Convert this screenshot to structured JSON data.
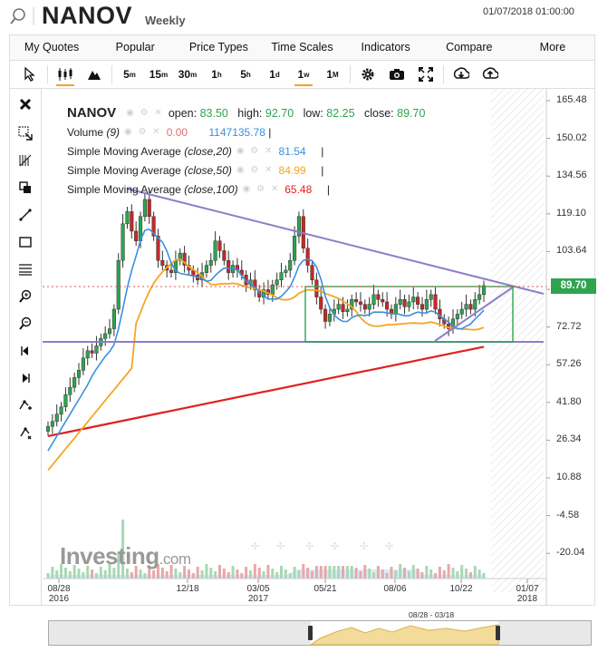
{
  "header": {
    "symbol": "NANOV",
    "period": "Weekly",
    "datetime": "01/07/2018 01:00:00",
    "search_icon": "search-icon"
  },
  "menu": {
    "items": [
      "My Quotes",
      "Popular",
      "Price Types",
      "Time Scales",
      "Indicators",
      "Compare",
      "More"
    ]
  },
  "toolbar": {
    "cursor_icon": "cursor-arrow-icon",
    "candles_icon": "candlestick-icon",
    "area_icon": "mountain-chart-icon",
    "timeframes": [
      "5",
      "15",
      "30",
      "1",
      "5",
      "1",
      "1",
      "1"
    ],
    "timeframe_units": [
      "m",
      "m",
      "m",
      "h",
      "h",
      "d",
      "w",
      "M"
    ],
    "active_timeframe": "1w",
    "settings_icon": "gear-icon",
    "camera_icon": "camera-icon",
    "fullscreen_icon": "fullscreen-icon",
    "download_icon": "download-icon",
    "upload_icon": "upload-icon"
  },
  "left_tools": [
    "close-icon",
    "crosshair-icon",
    "fibonacci-icon",
    "copy-icon",
    "line-tool-icon",
    "rectangle-icon",
    "horizontal-lines-icon",
    "zoom-in-icon",
    "zoom-out-icon",
    "back-icon",
    "forward-icon",
    "magnet-icon",
    "pointer-icon"
  ],
  "legend": {
    "title": "NANOV",
    "open_label": "open:",
    "open": "83.50",
    "high_label": "high:",
    "high": "92.70",
    "low_label": "low:",
    "low": "82.25",
    "close_label": "close:",
    "close": "89.70",
    "volume_label": "Volume",
    "volume_param": "(9)",
    "volume_ma": "0.00",
    "volume": "1147135.78",
    "sma20_label": "Simple Moving Average",
    "sma20_param": "(close,20)",
    "sma20": "81.54",
    "sma50_label": "Simple Moving Average",
    "sma50_param": "(close,50)",
    "sma50": "84.99",
    "sma100_label": "Simple Moving Average",
    "sma100_param": "(close,100)",
    "sma100": "65.48",
    "colors": {
      "sma20": "#3b8fe0",
      "sma50": "#f5a623",
      "sma100": "#e02020",
      "volume_ma": "#e07070",
      "volume": "#3b8fe0",
      "up": "#2ea44f",
      "down": "#c62828"
    }
  },
  "price_tag": "89.70",
  "chart_data": {
    "type": "candlestick",
    "y_axis_labels": [
      "165.48",
      "150.02",
      "134.56",
      "119.10",
      "103.64",
      "88.18",
      "72.72",
      "57.26",
      "41.80",
      "26.34",
      "10.88",
      "-4.58",
      "-20.04"
    ],
    "x_axis_labels": [
      {
        "top": "08/28",
        "bottom": "2016"
      },
      {
        "top": "12/18",
        "bottom": ""
      },
      {
        "top": "03/05",
        "bottom": "2017"
      },
      {
        "top": "05/21",
        "bottom": ""
      },
      {
        "top": "08/06",
        "bottom": ""
      },
      {
        "top": "10/22",
        "bottom": ""
      },
      {
        "top": "01/07",
        "bottom": "2018"
      }
    ],
    "ylim": [
      -20.04,
      165.48
    ],
    "last_close": 89.7,
    "series": [
      {
        "name": "SMA(close,20)",
        "color": "#3b8fe0"
      },
      {
        "name": "SMA(close,50)",
        "color": "#f5a623"
      },
      {
        "name": "SMA(close,100)",
        "color": "#e02020"
      }
    ]
  },
  "logo": {
    "brand": "Investing",
    "suffix": ".com"
  },
  "navigator": {
    "range": "08/28 - 03/18"
  }
}
